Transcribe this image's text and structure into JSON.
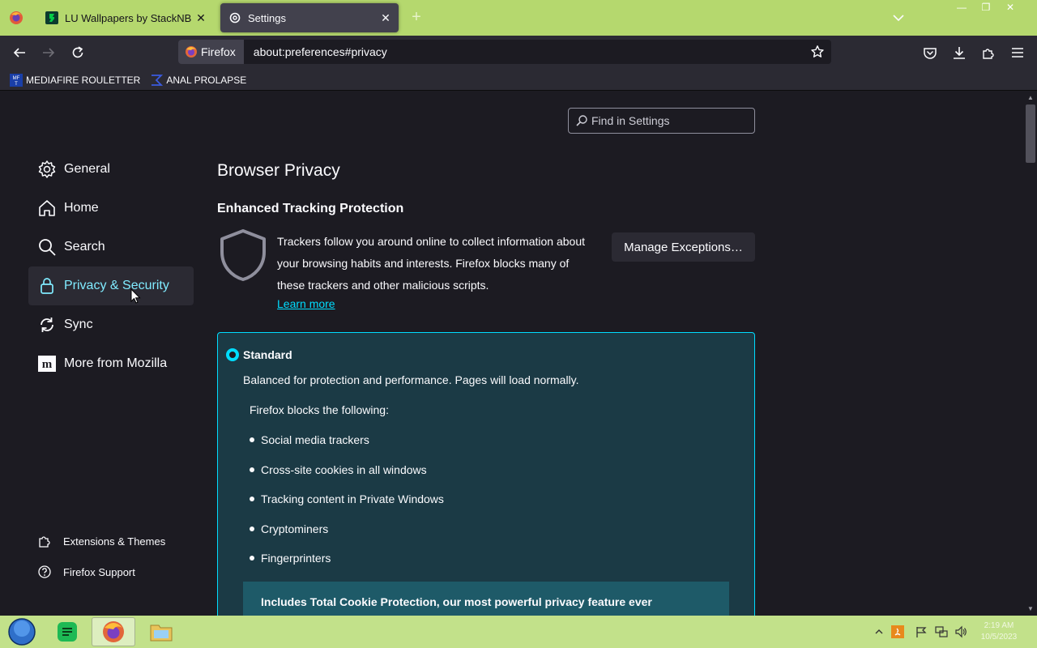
{
  "tabs": [
    {
      "title": "LU Wallpapers by StackNB on D",
      "favicon": "deviantart-icon",
      "active": false
    },
    {
      "title": "Settings",
      "favicon": "gear-icon",
      "active": true
    }
  ],
  "nav": {
    "identity_label": "Firefox",
    "url": "about:preferences#privacy"
  },
  "bookmarks": [
    {
      "label": "MEDIAFIRE ROULETTER",
      "icon": "mediafire-icon"
    },
    {
      "label": "ANAL PROLAPSE",
      "icon": "sigma-icon"
    }
  ],
  "settings": {
    "search_placeholder": "Find in Settings",
    "categories": [
      {
        "label": "General",
        "icon": "gear-icon"
      },
      {
        "label": "Home",
        "icon": "home-icon"
      },
      {
        "label": "Search",
        "icon": "search-icon"
      },
      {
        "label": "Privacy & Security",
        "icon": "lock-icon",
        "selected": true
      },
      {
        "label": "Sync",
        "icon": "sync-icon"
      },
      {
        "label": "More from Mozilla",
        "icon": "mozilla-icon"
      }
    ],
    "footer": [
      {
        "label": "Extensions & Themes",
        "icon": "puzzle-icon"
      },
      {
        "label": "Firefox Support",
        "icon": "help-icon"
      }
    ],
    "page_title": "Browser Privacy",
    "etp": {
      "heading": "Enhanced Tracking Protection",
      "description": "Trackers follow you around online to collect information about your browsing habits and interests. Firefox blocks many of these trackers and other malicious scripts.",
      "learn_more": "Learn more",
      "manage_button": "Manage Exceptions…"
    },
    "standard": {
      "title": "Standard",
      "description": "Balanced for protection and performance. Pages will load normally.",
      "blocks_heading": "Firefox blocks the following:",
      "blocks": [
        "Social media trackers",
        "Cross-site cookies in all windows",
        "Tracking content in Private Windows",
        "Cryptominers",
        "Fingerprinters"
      ],
      "tcp_banner": "Includes Total Cookie Protection, our most powerful privacy feature ever"
    }
  },
  "taskbar": {
    "apps": [
      "start-orb-icon",
      "notes-icon",
      "firefox-icon",
      "file-explorer-icon"
    ],
    "clock_time": "2:19 AM",
    "clock_date": "10/5/2023"
  },
  "colors": {
    "accent": "#00ddff",
    "selected_text": "#80ebff",
    "tabstrip": "#b5d86e",
    "taskbar": "#c2e18a",
    "card_bg": "#1b3a45"
  }
}
